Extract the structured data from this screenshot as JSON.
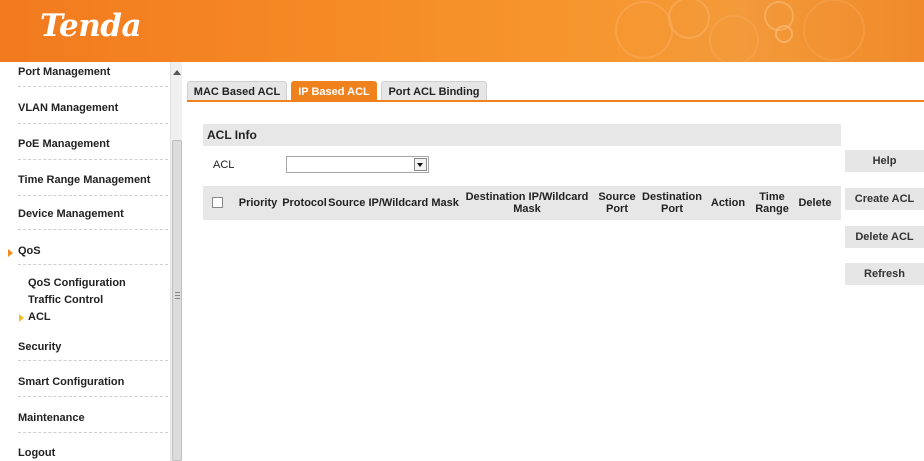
{
  "header": {
    "logo": "Tenda",
    "accent_color": "#f0821e"
  },
  "sidebar": {
    "items": [
      {
        "label": "Port Management"
      },
      {
        "label": "VLAN Management"
      },
      {
        "label": "PoE Management"
      },
      {
        "label": "Time Range Management"
      },
      {
        "label": "Device Management"
      },
      {
        "label": "QoS"
      },
      {
        "label": "Security"
      },
      {
        "label": "Smart Configuration"
      },
      {
        "label": "Maintenance"
      },
      {
        "label": "Logout"
      }
    ],
    "qos_sub": [
      {
        "label": "QoS Configuration"
      },
      {
        "label": "Traffic Control"
      },
      {
        "label": "ACL"
      }
    ]
  },
  "tabs": [
    {
      "label": "MAC Based ACL",
      "active": false
    },
    {
      "label": "IP Based ACL",
      "active": true
    },
    {
      "label": "Port ACL Binding",
      "active": false
    }
  ],
  "acl_info": {
    "title": "ACL Info",
    "acl_label": "ACL",
    "acl_selected": ""
  },
  "table": {
    "columns": [
      "Priority",
      "Protocol",
      "Source IP/Wildcard Mask",
      "Destination IP/Wildcard Mask",
      "Source Port",
      "Destination Port",
      "Action",
      "Time Range",
      "Delete"
    ],
    "rows": []
  },
  "buttons": {
    "help": "Help",
    "create": "Create ACL",
    "delete": "Delete ACL",
    "refresh": "Refresh"
  }
}
